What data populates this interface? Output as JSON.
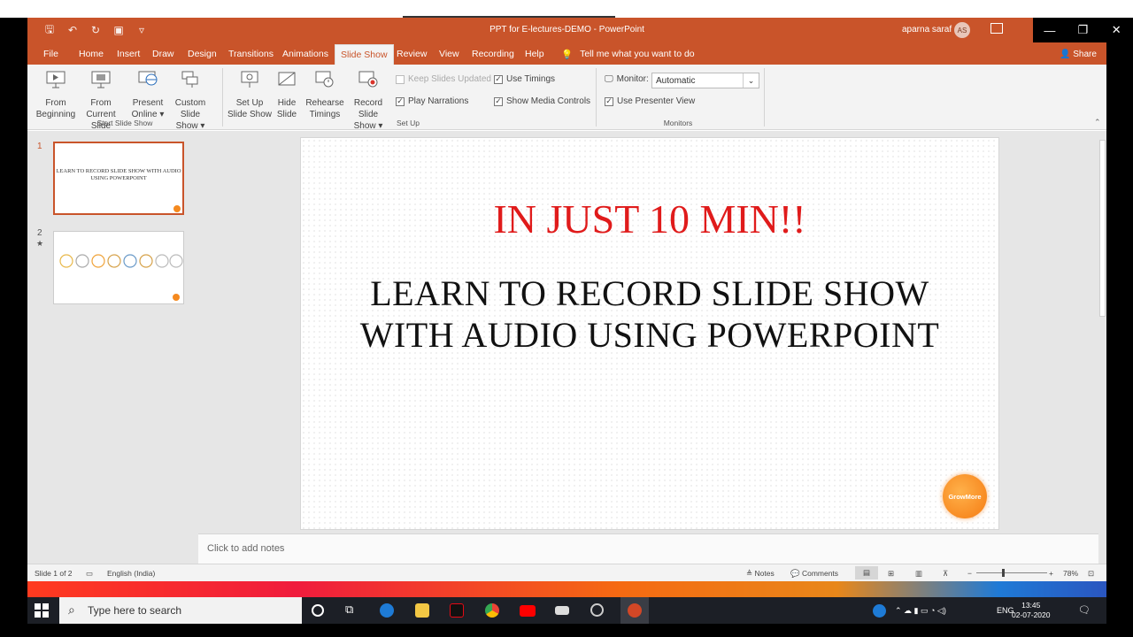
{
  "window": {
    "title": "PPT for E-lectures-DEMO  -  PowerPoint",
    "user_name": "aparna saraf",
    "user_initials": "AS"
  },
  "tabs": [
    "File",
    "Home",
    "Insert",
    "Draw",
    "Design",
    "Transitions",
    "Animations",
    "Slide Show",
    "Review",
    "View",
    "Recording",
    "Help"
  ],
  "tell_me": "Tell me what you want to do",
  "share": "Share",
  "ribbon": {
    "start_group": {
      "label": "Start Slide Show",
      "from_beginning": [
        "From",
        "Beginning"
      ],
      "from_current": [
        "From",
        "Current Slide"
      ],
      "present_online": [
        "Present",
        "Online ▾"
      ],
      "custom_show": [
        "Custom Slide",
        "Show ▾"
      ]
    },
    "setup_group": {
      "label": "Set Up",
      "setup_show": [
        "Set Up",
        "Slide Show"
      ],
      "hide_slide": [
        "Hide",
        "Slide"
      ],
      "rehearse": [
        "Rehearse",
        "Timings"
      ],
      "record": [
        "Record Slide",
        "Show ▾"
      ],
      "keep_updated": "Keep Slides Updated",
      "play_narrations": "Play Narrations",
      "use_timings": "Use Timings",
      "show_media_controls": "Show Media Controls"
    },
    "monitors_group": {
      "label": "Monitors",
      "monitor_label": "Monitor:",
      "monitor_value": "Automatic",
      "presenter_view": "Use Presenter View"
    }
  },
  "thumbnails": {
    "slide1_number": "1",
    "slide1_text": "LEARN TO RECORD SLIDE SHOW WITH AUDIO USING POWERPOINT",
    "slide2_number": "2",
    "slide2_mark": "★"
  },
  "slide": {
    "headline": "IN JUST 10 MIN!!",
    "subtitle_line1": "LEARN TO RECORD SLIDE SHOW",
    "subtitle_line2": "WITH AUDIO USING POWERPOINT",
    "logo_text": "GrowMore"
  },
  "notes_placeholder": "Click to add notes",
  "status": {
    "slide_count": "Slide 1 of 2",
    "language": "English (India)",
    "notes": "Notes",
    "comments": "Comments",
    "zoom": "78%"
  },
  "taskbar": {
    "search_placeholder": "Type here to search",
    "language": "ENG",
    "time": "13:45",
    "date": "02-07-2020"
  },
  "colors": {
    "accent": "#c9542a",
    "headline_red": "#e01b1b",
    "logo_orange": "#f57b12"
  }
}
